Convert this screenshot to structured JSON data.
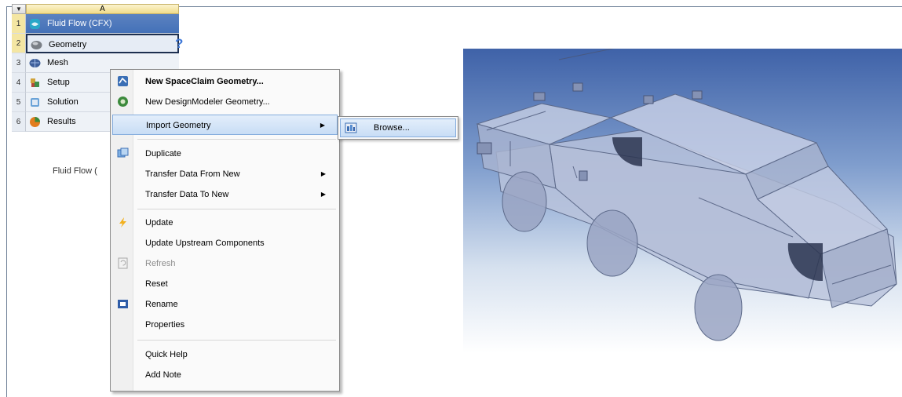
{
  "system": {
    "collapse_glyph": "▼",
    "column_header": "A",
    "rows": [
      {
        "num": "1",
        "label": "Fluid Flow (CFX)",
        "icon": "fluid-flow-icon"
      },
      {
        "num": "2",
        "label": "Geometry",
        "icon": "geometry-icon",
        "status": "?"
      },
      {
        "num": "3",
        "label": "Mesh",
        "icon": "mesh-icon"
      },
      {
        "num": "4",
        "label": "Setup",
        "icon": "setup-icon"
      },
      {
        "num": "5",
        "label": "Solution",
        "icon": "solution-icon"
      },
      {
        "num": "6",
        "label": "Results",
        "icon": "results-icon"
      }
    ],
    "name": "Fluid Flow ("
  },
  "context_menu": {
    "items": [
      {
        "label": "New SpaceClaim Geometry...",
        "icon": "spaceclaim-icon"
      },
      {
        "label": "New DesignModeler Geometry...",
        "icon": "designmodeler-icon"
      },
      {
        "label": "Import Geometry",
        "arrow": "▶"
      },
      {
        "label": "Duplicate",
        "icon": "duplicate-icon"
      },
      {
        "label": "Transfer Data From New",
        "arrow": "▶"
      },
      {
        "label": "Transfer Data To New",
        "arrow": "▶"
      },
      {
        "label": "Update",
        "icon": "update-lightning-icon"
      },
      {
        "label": "Update Upstream Components"
      },
      {
        "label": "Refresh",
        "icon": "refresh-icon"
      },
      {
        "label": "Reset"
      },
      {
        "label": "Rename",
        "icon": "rename-icon"
      },
      {
        "label": "Properties"
      },
      {
        "label": "Quick Help"
      },
      {
        "label": "Add Note"
      }
    ]
  },
  "submenu": {
    "items": [
      {
        "label": "Browse...",
        "icon": "browse-icon"
      }
    ]
  },
  "colors": {
    "selected_row": "#4471b8",
    "menu_highlight": "#c8ddf5",
    "viewport_top": "#3f62a8",
    "viewport_bottom": "#ffffff",
    "model_fill": "#b9c3dc"
  }
}
